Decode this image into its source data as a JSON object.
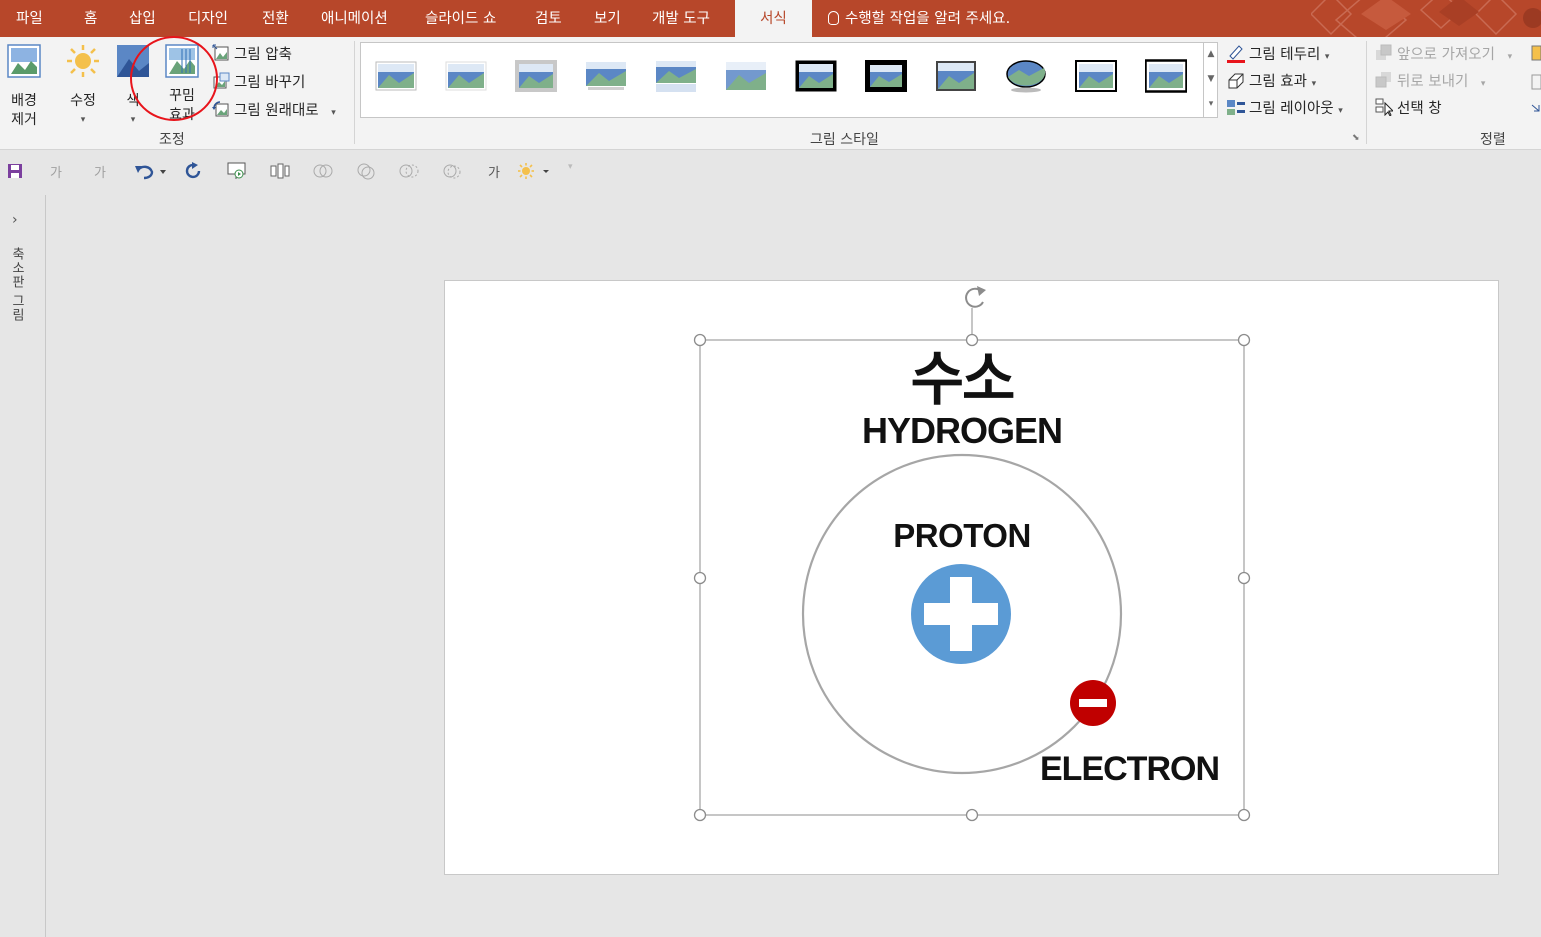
{
  "tabs": [
    "파일",
    "홈",
    "삽입",
    "디자인",
    "전환",
    "애니메이션",
    "슬라이드 쇼",
    "검토",
    "보기",
    "개발 도구",
    "서식"
  ],
  "active_tab": "서식",
  "tell_me": "수행할 작업을 알려 주세요.",
  "ribbon": {
    "adjust": {
      "remove_bg_line1": "배경",
      "remove_bg_line2": "제거",
      "corrections": "수정",
      "color": "색",
      "artistic_line1": "꾸밈",
      "artistic_line2": "효과",
      "compress": "그림 압축",
      "change": "그림 바꾸기",
      "reset": "그림 원래대로",
      "group_label": "조정"
    },
    "styles": {
      "group_label": "그림 스타일"
    },
    "picture_format": {
      "border": "그림 테두리",
      "effects": "그림 효과",
      "layout": "그림 레이아웃"
    },
    "arrange": {
      "bring_forward": "앞으로 가져오기",
      "send_backward": "뒤로 보내기",
      "selection_pane": "선택 창",
      "group_label": "정렬"
    }
  },
  "qat": {
    "font_glyph": "가"
  },
  "thumbnail_rail": {
    "label": "축소판 그림"
  },
  "slide": {
    "title_ko": "수소",
    "title_en": "HYDROGEN",
    "proton_label": "PROTON",
    "electron_label": "ELECTRON"
  },
  "colors": {
    "accent": "#b7472a",
    "proton": "#5b9bd5",
    "electron": "#c00000",
    "highlight_circle": "#e8141b"
  }
}
